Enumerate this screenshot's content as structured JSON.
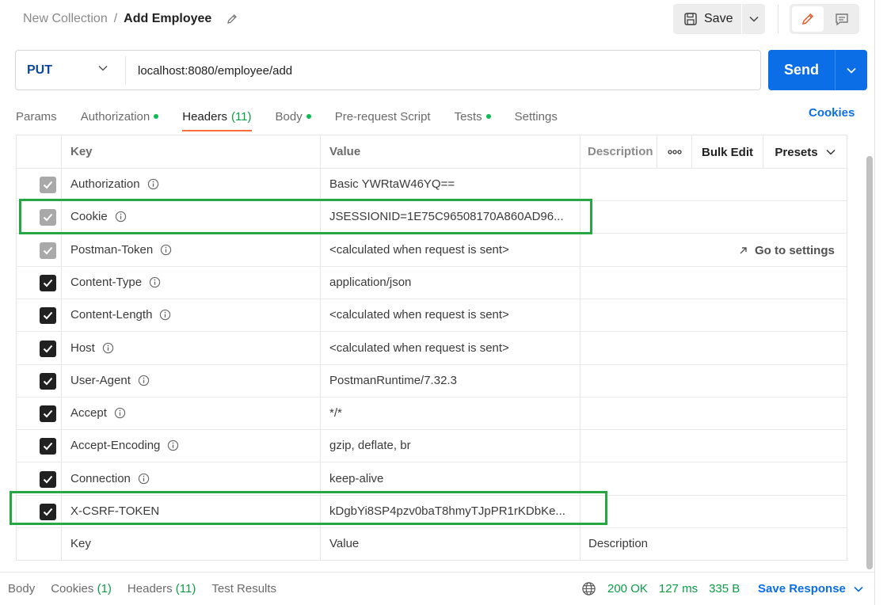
{
  "breadcrumb": {
    "parent": "New Collection",
    "separator": "/",
    "current": "Add Employee"
  },
  "toolbar": {
    "save_label": "Save"
  },
  "request": {
    "method": "PUT",
    "url": "localhost:8080/employee/add",
    "send_label": "Send"
  },
  "tabs": [
    {
      "label": "Params"
    },
    {
      "label": "Authorization"
    },
    {
      "label": "Headers",
      "count": "(11)"
    },
    {
      "label": "Body"
    },
    {
      "label": "Pre-request Script"
    },
    {
      "label": "Tests"
    },
    {
      "label": "Settings"
    }
  ],
  "cookies_link": "Cookies",
  "table": {
    "headers": {
      "key": "Key",
      "value": "Value",
      "description": "Description",
      "bulk_edit": "Bulk Edit",
      "presets": "Presets"
    },
    "rows": [
      {
        "key": "Authorization",
        "value": "Basic YWRtaW46YQ=="
      },
      {
        "key": "Cookie",
        "value": "JSESSIONID=1E75C96508170A860AD96..."
      },
      {
        "key": "Postman-Token",
        "value": "<calculated when request is sent>",
        "extra": "Go to settings"
      },
      {
        "key": "Content-Type",
        "value": "application/json"
      },
      {
        "key": "Content-Length",
        "value": "<calculated when request is sent>"
      },
      {
        "key": "Host",
        "value": "<calculated when request is sent>"
      },
      {
        "key": "User-Agent",
        "value": "PostmanRuntime/7.32.3"
      },
      {
        "key": "Accept",
        "value": "*/*"
      },
      {
        "key": "Accept-Encoding",
        "value": "gzip, deflate, br"
      },
      {
        "key": "Connection",
        "value": "keep-alive"
      },
      {
        "key": "X-CSRF-TOKEN",
        "value": "kDgbYi8SP4pzv0baT8hmyTJpPR1rKDbKe..."
      }
    ],
    "new_row": {
      "key": "Key",
      "value": "Value",
      "description": "Description"
    }
  },
  "footer": {
    "tabs": [
      {
        "label": "Body"
      },
      {
        "label": "Cookies",
        "count": "(1)"
      },
      {
        "label": "Headers",
        "count": "(11)"
      },
      {
        "label": "Test Results"
      }
    ],
    "status": "200 OK",
    "time": "127 ms",
    "size": "335 B",
    "save_response": "Save Response"
  },
  "colors": {
    "accent_blue": "#0b6ee6",
    "success_green": "#0a9d45",
    "tab_underline": "#ff6c37",
    "highlight": "#27a744"
  }
}
